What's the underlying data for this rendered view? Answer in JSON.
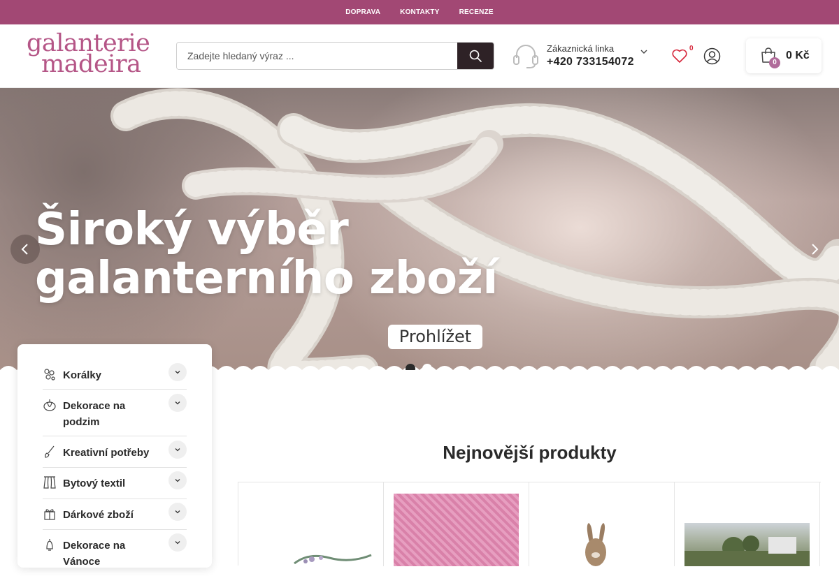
{
  "topbar": {
    "links": [
      "DOPRAVA",
      "KONTAKTY",
      "RECENZE"
    ]
  },
  "header": {
    "logo_line1": "galanterie",
    "logo_line2": "madeira",
    "search_placeholder": "Zadejte hledaný výraz ...",
    "support_label": "Zákaznická linka",
    "support_phone": "+420 733154072",
    "wishlist_count": "0",
    "cart_count": "0",
    "cart_total": "0 Kč"
  },
  "hero": {
    "title_line1": "Široký výběr",
    "title_line2": "galanterního zboží",
    "button_label": "Prohlížet",
    "slides": 2,
    "active_slide": 1
  },
  "categories": [
    {
      "label": "Korálky",
      "icon": "beads-icon"
    },
    {
      "label": "Dekorace na podzim",
      "icon": "pumpkin-icon"
    },
    {
      "label": "Kreativní potřeby",
      "icon": "brush-icon"
    },
    {
      "label": "Bytový textil",
      "icon": "curtain-icon"
    },
    {
      "label": "Dárkové zboží",
      "icon": "gift-icon"
    },
    {
      "label": "Dekorace na Vánoce",
      "icon": "bell-icon"
    }
  ],
  "products_section": {
    "title": "Nejnovější produkty"
  },
  "colors": {
    "brand": "#a24874",
    "logo": "#b55687",
    "search_button": "#2e2226",
    "wishlist_badge": "#d6263a",
    "cart_badge": "#b06b9a"
  }
}
